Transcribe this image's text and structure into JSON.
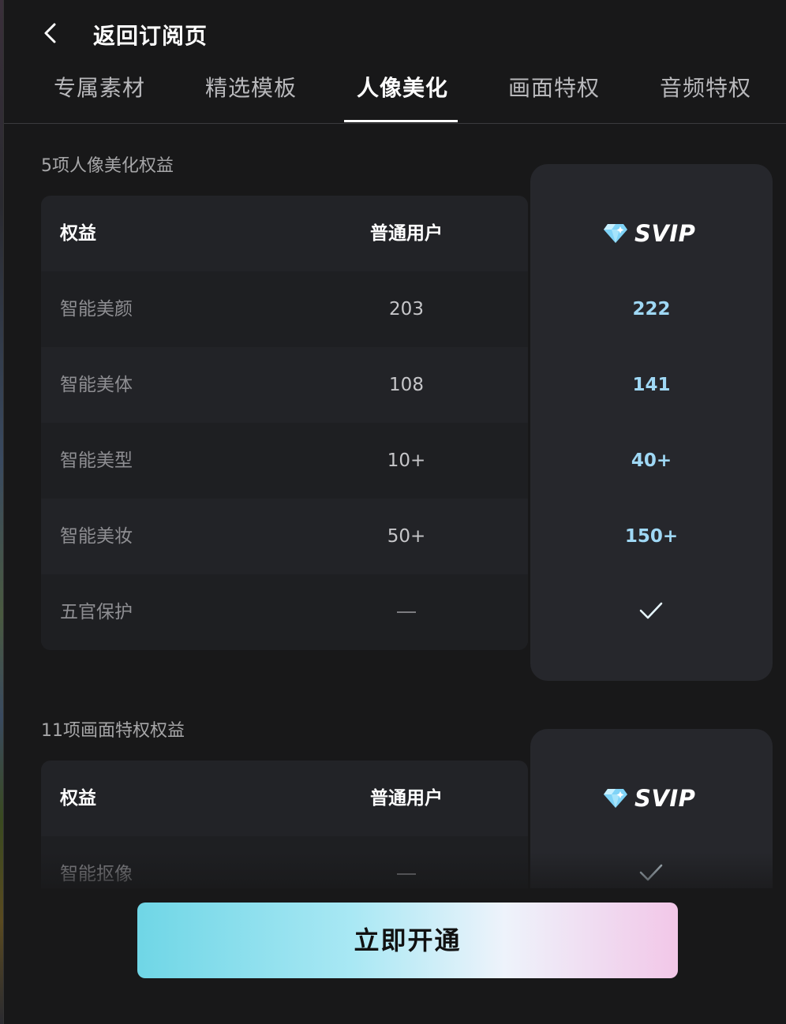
{
  "header": {
    "back_label": "返回订阅页"
  },
  "tabs": [
    {
      "label": "专属素材"
    },
    {
      "label": "精选模板"
    },
    {
      "label": "人像美化",
      "active": true
    },
    {
      "label": "画面特权"
    },
    {
      "label": "音频特权"
    }
  ],
  "section1": {
    "title": "5项人像美化权益",
    "header": {
      "name": "权益",
      "normal": "普通用户",
      "svip": "SVIP"
    },
    "rows": [
      {
        "name": "智能美颜",
        "normal": "203",
        "svip": "222"
      },
      {
        "name": "智能美体",
        "normal": "108",
        "svip": "141"
      },
      {
        "name": "智能美型",
        "normal": "10+",
        "svip": "40+"
      },
      {
        "name": "智能美妆",
        "normal": "50+",
        "svip": "150+"
      },
      {
        "name": "五官保护",
        "normal": "dash",
        "svip": "check"
      }
    ]
  },
  "section2": {
    "title": "11项画面特权权益",
    "header": {
      "name": "权益",
      "normal": "普通用户",
      "svip": "SVIP"
    },
    "rows": [
      {
        "name": "智能抠像",
        "normal": "dash",
        "svip": "check"
      }
    ]
  },
  "cta": {
    "label": "立即开通"
  },
  "colors": {
    "svip_value": "#9fd8f5",
    "accent_gradient": [
      "#6fd6e6",
      "#eef3fb",
      "#f2c7e8"
    ]
  }
}
